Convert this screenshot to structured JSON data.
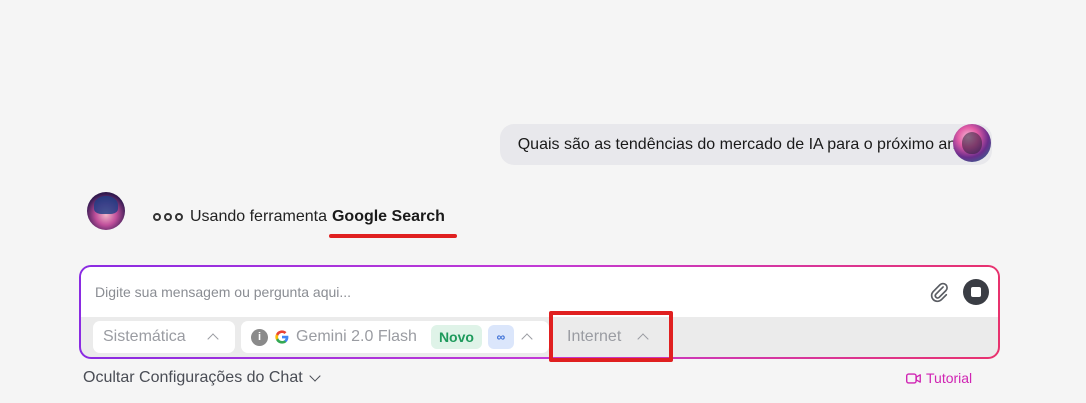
{
  "chat": {
    "user_message": "Quais são as tendências do mercado de IA para o próximo ano?",
    "tool_status_prefix": "Usando ferramenta",
    "tool_name": "Google Search"
  },
  "composer": {
    "placeholder": "Digite sua mensagem ou pergunta aqui...",
    "mode_select": "Sistemática",
    "model_select": "Gemini 2.0 Flash",
    "model_badge_new": "Novo",
    "model_badge_infinity": "∞",
    "web_select": "Internet"
  },
  "footer": {
    "hide_settings_label": "Ocultar Configurações do Chat",
    "tutorial_label": "Tutorial"
  },
  "colors": {
    "accent_magenta": "#d025b3",
    "gradient_start": "#8a2be2",
    "gradient_end": "#e8326e",
    "annotation_red": "#e02020",
    "badge_new_text": "#1e9a5c"
  },
  "icons": {
    "attach": "paperclip-icon",
    "stop": "stop-icon",
    "info": "info-icon",
    "google": "google-icon",
    "tutorial": "video-camera-icon"
  }
}
